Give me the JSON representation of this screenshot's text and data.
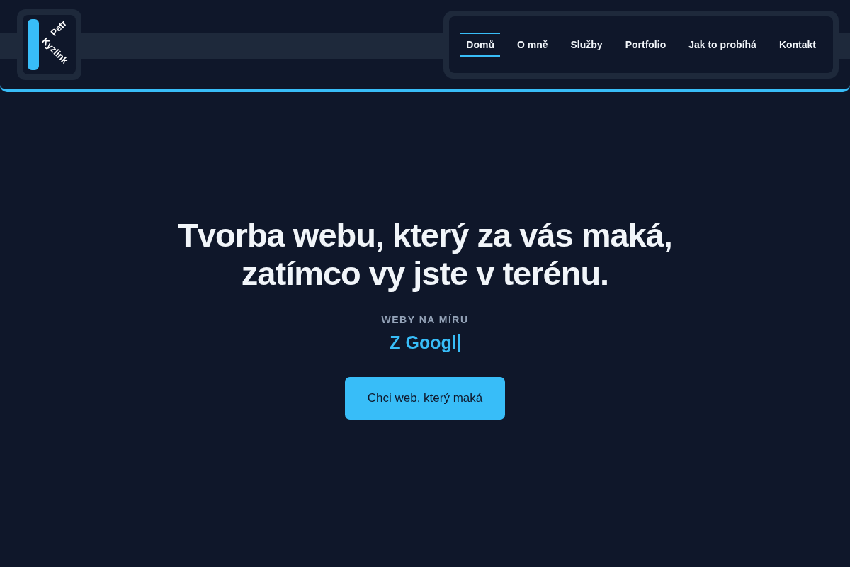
{
  "logo": {
    "first_name": "Petr",
    "last_name": "Kyzlink"
  },
  "nav": [
    {
      "label": "Domů",
      "selected": true
    },
    {
      "label": "O mně",
      "selected": false
    },
    {
      "label": "Služby",
      "selected": false
    },
    {
      "label": "Portfolio",
      "selected": false
    },
    {
      "label": "Jak to probíhá",
      "selected": false
    },
    {
      "label": "Kontakt",
      "selected": false
    }
  ],
  "hero": {
    "title_lines": [
      "Tvorba webu, který za vás maká,",
      "zatímco vy jste v terénu."
    ],
    "eyebrow": "WEBY NA MÍRU",
    "typed_text": "Z Googl",
    "cta": "Chci web, který maká"
  }
}
